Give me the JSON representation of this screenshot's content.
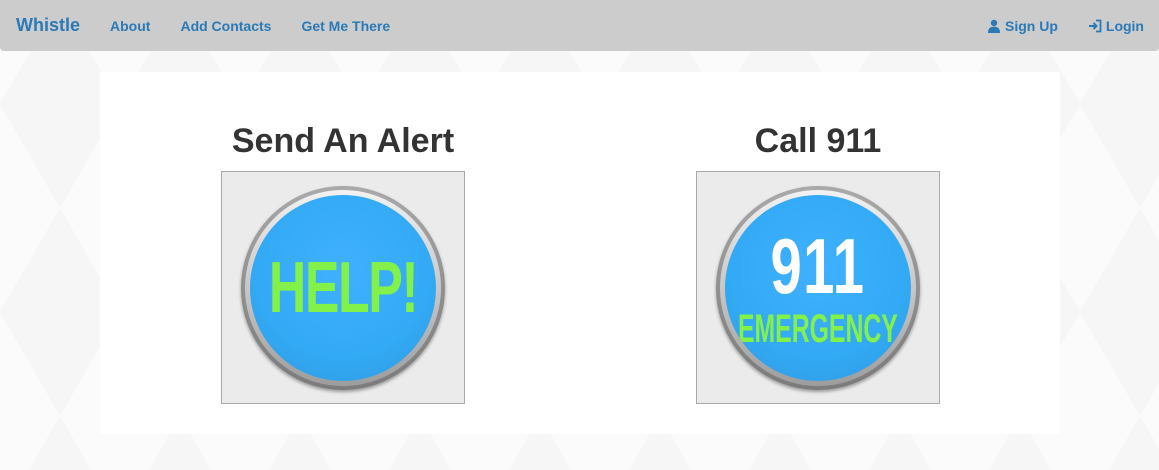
{
  "navbar": {
    "brand": "Whistle",
    "links": [
      "About",
      "Add Contacts",
      "Get Me There"
    ],
    "right": {
      "signup": {
        "label": "Sign Up",
        "icon": "user-icon"
      },
      "login": {
        "label": "Login",
        "icon": "login-icon"
      }
    },
    "colors": {
      "background": "#cccccc",
      "link": "#2a7ab8"
    }
  },
  "main": {
    "alert": {
      "title": "Send An Alert",
      "button_text": "HELP!"
    },
    "call": {
      "title": "Call 911",
      "button_number": "911",
      "button_subtext": "EMERGENCY"
    }
  },
  "colors": {
    "button_face": "#33aaf5",
    "button_text_green": "#82f24a"
  }
}
